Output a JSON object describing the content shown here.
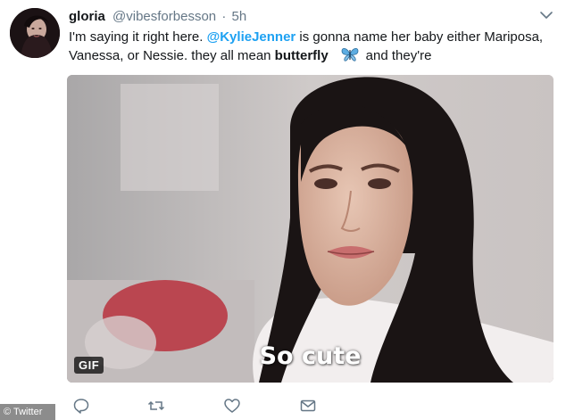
{
  "tweet": {
    "display_name": "gloria",
    "handle": "@vibesforbesson",
    "separator": "·",
    "time": "5h",
    "text_before_mention": "I'm saying it right here. ",
    "mention": "@KylieJenner",
    "text_after_mention": " is gonna name her baby either Mariposa, Vanessa, or Nessie. they all mean ",
    "bold_word": "butterfly",
    "butterfly_icon": "butterfly-emoji",
    "text_end": "and they're",
    "accent_color": "#1da1f2"
  },
  "media": {
    "badge": "GIF",
    "caption": "So cute"
  },
  "actions": [
    {
      "name": "reply-icon"
    },
    {
      "name": "retweet-icon"
    },
    {
      "name": "like-icon"
    },
    {
      "name": "message-icon"
    }
  ],
  "credit": "© Twitter"
}
